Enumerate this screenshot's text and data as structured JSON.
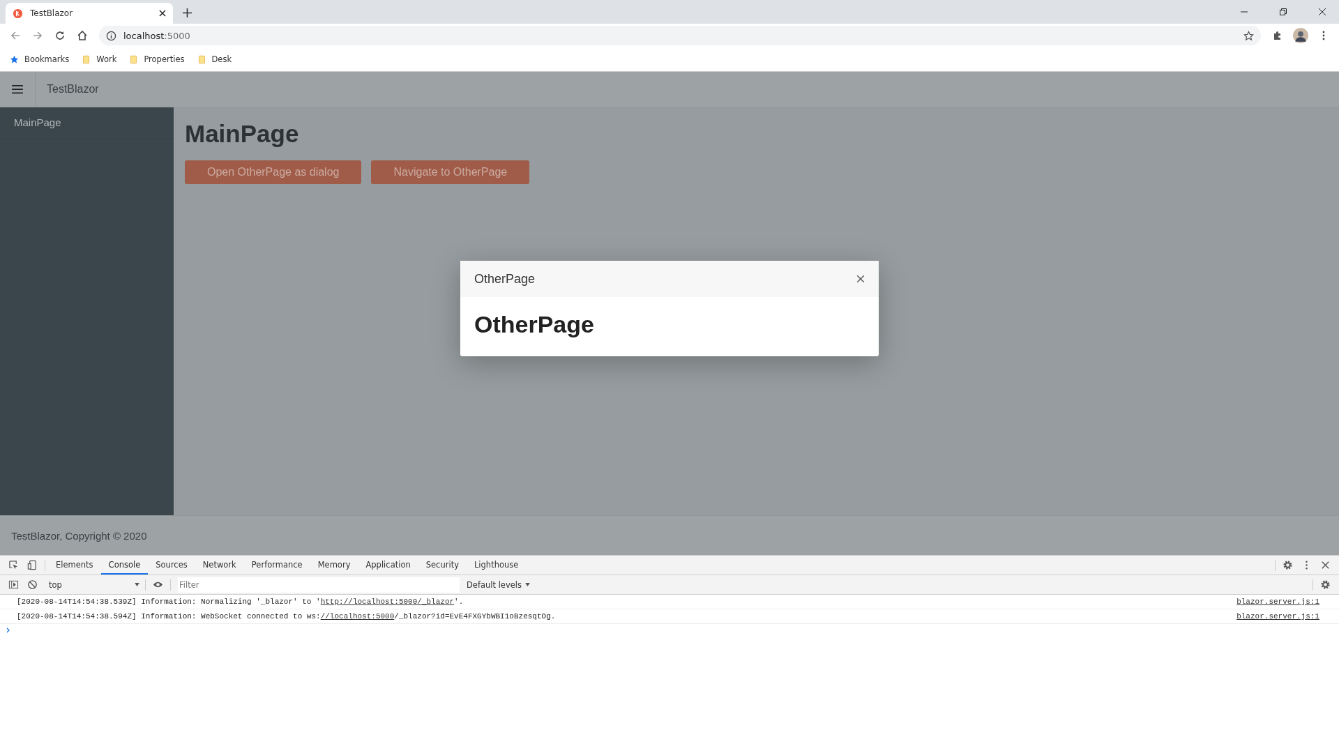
{
  "browser": {
    "tab": {
      "title": "TestBlazor"
    },
    "address": {
      "host": "localhost",
      "port": ":5000"
    },
    "bookmarks": [
      {
        "label": "Bookmarks",
        "kind": "star"
      },
      {
        "label": "Work",
        "kind": "folder"
      },
      {
        "label": "Properties",
        "kind": "folder"
      },
      {
        "label": "Desk",
        "kind": "folder"
      }
    ]
  },
  "app": {
    "title": "TestBlazor",
    "nav": [
      "MainPage"
    ],
    "heading": "MainPage",
    "buttons": [
      "Open OtherPage as dialog",
      "Navigate to OtherPage"
    ],
    "footer": "TestBlazor, Copyright © 2020"
  },
  "dialog": {
    "title": "OtherPage",
    "heading": "OtherPage"
  },
  "devtools": {
    "tabs": [
      {
        "label": "Elements",
        "selected": false
      },
      {
        "label": "Console",
        "selected": true
      },
      {
        "label": "Sources",
        "selected": false
      },
      {
        "label": "Network",
        "selected": false
      },
      {
        "label": "Performance",
        "selected": false
      },
      {
        "label": "Memory",
        "selected": false
      },
      {
        "label": "Application",
        "selected": false
      },
      {
        "label": "Security",
        "selected": false
      },
      {
        "label": "Lighthouse",
        "selected": false
      }
    ],
    "context": "top",
    "filter": {
      "placeholder": "Filter"
    },
    "levels": "Default levels",
    "logs": [
      {
        "before": "[2020-08-14T14:54:38.539Z] Information: Normalizing '_blazor' to '",
        "link": "http://localhost:5000/_blazor",
        "after": "'.",
        "source": "blazor.server.js:1"
      },
      {
        "before": "[2020-08-14T14:54:38.594Z] Information: WebSocket connected to ws:",
        "link": "//localhost:5000",
        "after": "/_blazor?id=EvE4FXGYbWBI1oBzesqtOg.",
        "source": "blazor.server.js:1"
      }
    ]
  }
}
